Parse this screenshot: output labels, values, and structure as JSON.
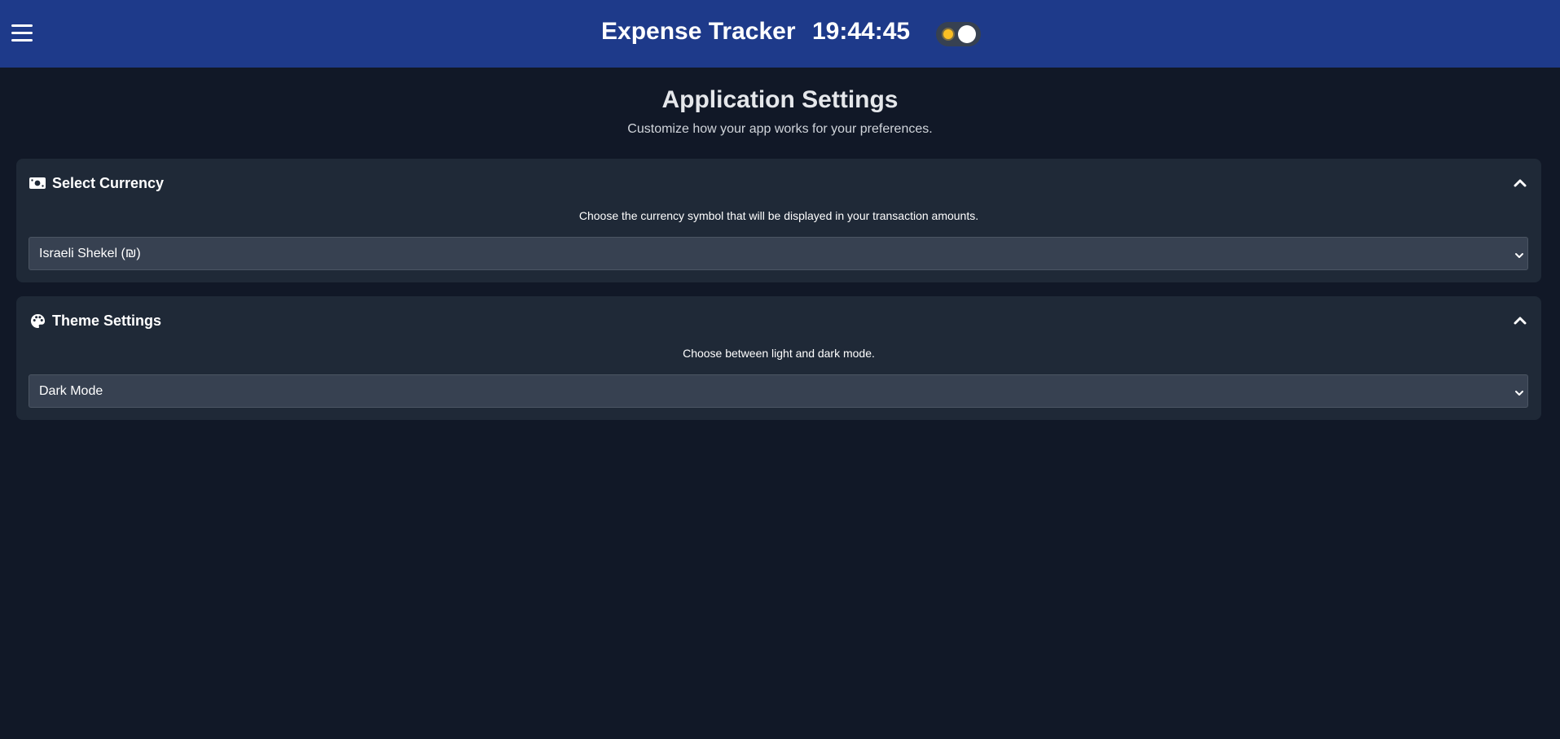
{
  "header": {
    "app_title": "Expense Tracker",
    "clock": "19:44:45",
    "menu_icon": "hamburger-menu-icon",
    "theme_toggle": {
      "state": "light-toggle-off",
      "icon": "sun-icon"
    }
  },
  "page": {
    "title": "Application Settings",
    "subtitle": "Customize how your app works for your preferences."
  },
  "sections": {
    "currency": {
      "icon": "money-icon",
      "title": "Select Currency",
      "description": "Choose the currency symbol that will be displayed in your transaction amounts.",
      "selected": "Israeli Shekel (₪)",
      "collapse_icon": "chevron-up-icon"
    },
    "theme": {
      "icon": "palette-icon",
      "title": "Theme Settings",
      "description": "Choose between light and dark mode.",
      "selected": "Dark Mode",
      "collapse_icon": "chevron-up-icon"
    }
  },
  "colors": {
    "header_bg": "#1e3a8a",
    "page_bg": "#111827",
    "card_bg": "#1f2937",
    "select_bg": "#374151",
    "sun": "#fbbf24"
  }
}
